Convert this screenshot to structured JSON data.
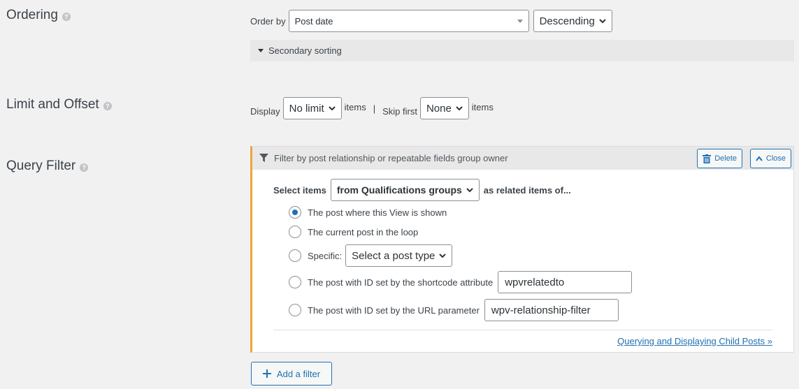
{
  "ordering": {
    "title": "Ordering",
    "order_by_label": "Order by",
    "order_by_value": "Post date",
    "direction_value": "Descending",
    "secondary_label": "Secondary sorting"
  },
  "limit": {
    "title": "Limit and Offset",
    "display_label": "Display",
    "display_value": "No limit",
    "items_label_1": "items",
    "separator": "|",
    "skip_label": "Skip first",
    "skip_value": "None",
    "items_label_2": "items"
  },
  "query_filter": {
    "title": "Query Filter",
    "header_text": "Filter by post relationship or repeatable fields group owner",
    "delete_label": "Delete",
    "close_label": "Close",
    "select_items_label": "Select items",
    "select_items_value": "from Qualifications groups",
    "related_text": "as related items of...",
    "options": [
      {
        "label": "The post where this View is shown",
        "selected": true
      },
      {
        "label": "The current post in the loop",
        "selected": false
      },
      {
        "label": "Specific:",
        "selected": false
      },
      {
        "label": "The post with ID set by the shortcode attribute",
        "selected": false
      },
      {
        "label": "The post with ID set by the URL parameter",
        "selected": false
      }
    ],
    "specific_select_value": "Select a post type",
    "shortcode_value": "wpvrelatedto",
    "url_param_value": "wpv-relationship-filter",
    "help_link": "Querying and Displaying Child Posts »",
    "add_filter_label": "Add a filter"
  },
  "colors": {
    "accent": "#2271b1",
    "filter_border": "#f0a33a",
    "background": "#f1f1f1"
  }
}
